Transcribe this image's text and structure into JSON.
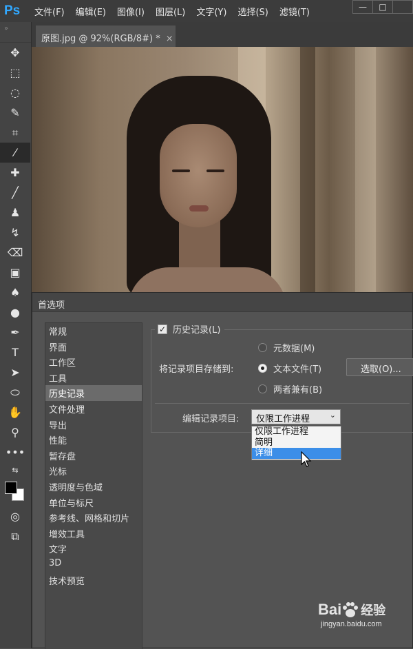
{
  "app": {
    "logo": "Ps"
  },
  "menu": [
    "文件(F)",
    "编辑(E)",
    "图像(I)",
    "图层(L)",
    "文字(Y)",
    "选择(S)",
    "滤镜(T)"
  ],
  "window_controls": {
    "minimize": "—",
    "maximize": "□"
  },
  "document": {
    "tab_title": "原图.jpg @ 92%(RGB/8#) *",
    "close": "×"
  },
  "tools": [
    {
      "name": "move-tool",
      "glyph": "✥"
    },
    {
      "name": "marquee-tool",
      "glyph": "⬚"
    },
    {
      "name": "lasso-tool",
      "glyph": "◌"
    },
    {
      "name": "quick-select-tool",
      "glyph": "✎"
    },
    {
      "name": "crop-tool",
      "glyph": "⌗"
    },
    {
      "name": "eyedropper-tool",
      "glyph": "⁄"
    },
    {
      "name": "healing-tool",
      "glyph": "✚"
    },
    {
      "name": "brush-tool",
      "glyph": "╱"
    },
    {
      "name": "stamp-tool",
      "glyph": "♟"
    },
    {
      "name": "history-brush-tool",
      "glyph": "↯"
    },
    {
      "name": "eraser-tool",
      "glyph": "⌫"
    },
    {
      "name": "gradient-tool",
      "glyph": "▣"
    },
    {
      "name": "blur-tool",
      "glyph": "♠"
    },
    {
      "name": "dodge-tool",
      "glyph": "●"
    },
    {
      "name": "pen-tool",
      "glyph": "✒"
    },
    {
      "name": "type-tool",
      "glyph": "T"
    },
    {
      "name": "path-select-tool",
      "glyph": "➤"
    },
    {
      "name": "shape-tool",
      "glyph": "⬭"
    },
    {
      "name": "hand-tool",
      "glyph": "✋"
    },
    {
      "name": "zoom-tool",
      "glyph": "⚲"
    },
    {
      "name": "more-tools",
      "glyph": "•••"
    }
  ],
  "dialog": {
    "title": "首选项",
    "sidebar": [
      "常规",
      "界面",
      "工作区",
      "工具",
      "历史记录",
      "文件处理",
      "导出",
      "性能",
      "暂存盘",
      "光标",
      "透明度与色域",
      "单位与标尺",
      "参考线、网格和切片",
      "增效工具",
      "文字",
      "3D",
      "技术预览"
    ],
    "selected_index": 4,
    "history": {
      "checkbox_label": "历史记录(L)",
      "checked": true,
      "save_to_label": "将记录项目存储到:",
      "options": [
        "元数据(M)",
        "文本文件(T)",
        "两者兼有(B)"
      ],
      "selected_option": "文本文件(T)",
      "choose_button": "选取(O)...",
      "edit_log_label": "编辑记录项目:",
      "edit_log_value": "仅限工作进程",
      "dropdown_options": [
        "仅限工作进程",
        "简明",
        "详细"
      ],
      "highlighted_option": "详细"
    }
  },
  "watermark": {
    "brand": "Bai",
    "brand2": "经验",
    "url": "jingyan.baidu.com"
  }
}
